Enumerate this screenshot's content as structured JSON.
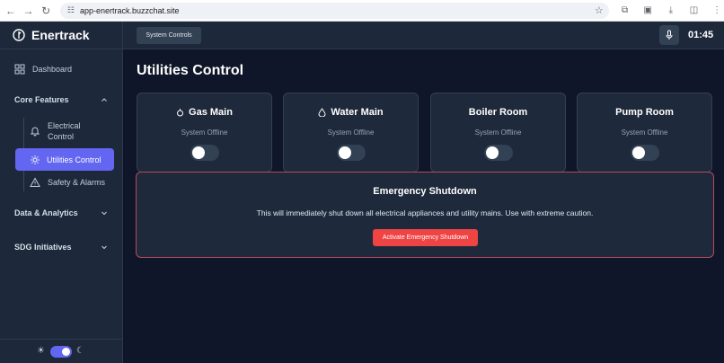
{
  "browser": {
    "url": "app-enertrack.buzzchat.site"
  },
  "app": {
    "name": "Enertrack",
    "accent_color": "#6366f1",
    "danger_color": "#ef4444"
  },
  "sidebar": {
    "dashboard_label": "Dashboard",
    "core_features_label": "Core Features",
    "sub_items": [
      {
        "label_line1": "Electrical",
        "label_line2": "Control",
        "icon": "bell-icon"
      },
      {
        "label": "Utilities Control",
        "icon": "gear-icon",
        "active": true
      },
      {
        "label": "Safety & Alarms",
        "icon": "warning-icon"
      }
    ],
    "data_analytics_label": "Data & Analytics",
    "sdg_label": "SDG Initiatives"
  },
  "header": {
    "system_controls_label": "System Controls",
    "time": "01:45"
  },
  "main": {
    "title": "Utilities Control",
    "cards": [
      {
        "title": "Gas Main",
        "status": "System Offline",
        "icon": "gas-icon",
        "enabled": false
      },
      {
        "title": "Water Main",
        "status": "System Offline",
        "icon": "water-drop-icon",
        "enabled": false
      },
      {
        "title": "Boiler Room",
        "status": "System Offline",
        "icon": "",
        "enabled": false
      },
      {
        "title": "Pump Room",
        "status": "System Offline",
        "icon": "",
        "enabled": false
      }
    ],
    "emergency": {
      "title": "Emergency Shutdown",
      "description": "This will immediately shut down all electrical appliances and utility mains. Use with extreme caution.",
      "button_label": "Activate Emergency Shutdown"
    }
  }
}
